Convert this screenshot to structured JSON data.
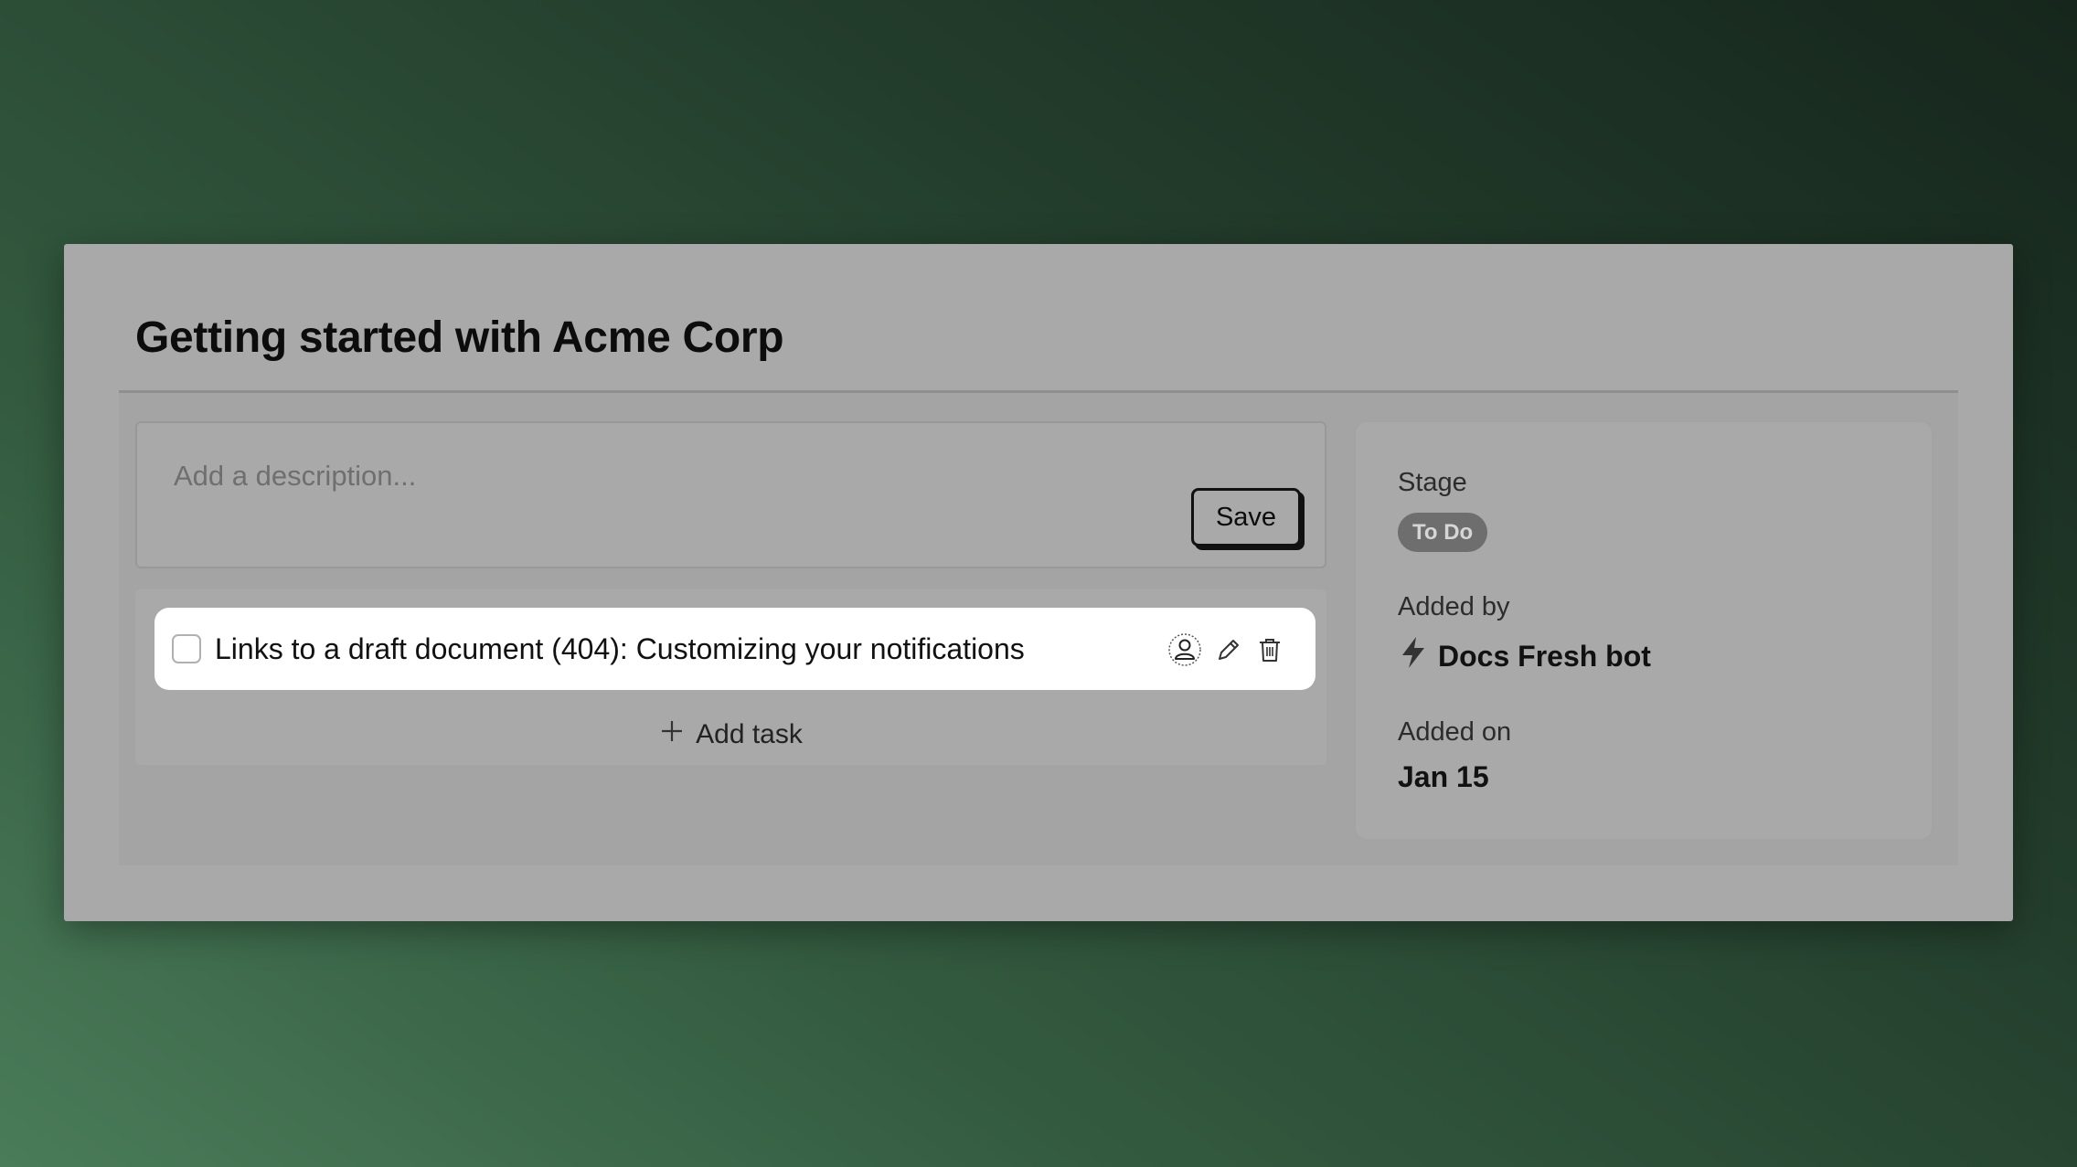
{
  "card": {
    "title": "Getting started with Acme Corp"
  },
  "description": {
    "placeholder": "Add a description...",
    "save_label": "Save"
  },
  "tasks": {
    "items": [
      {
        "text": "Links to a draft document (404): Customizing your notifications",
        "checked": false,
        "actions": [
          "user-assign-icon",
          "pencil-icon",
          "trash-icon"
        ]
      }
    ],
    "add_label": "Add task",
    "add_icon": "plus-icon"
  },
  "details": {
    "stage_label": "Stage",
    "stage_value": "To Do",
    "added_by_label": "Added by",
    "added_by_value": "Docs Fresh bot",
    "added_by_icon": "lightning-bolt-icon",
    "added_on_label": "Added on",
    "added_on_value": "Jan 15"
  },
  "colors": {
    "overlay_card": "#a9a9a9",
    "badge_bg": "#6e6e6e",
    "task_row_bg": "#ffffff"
  }
}
